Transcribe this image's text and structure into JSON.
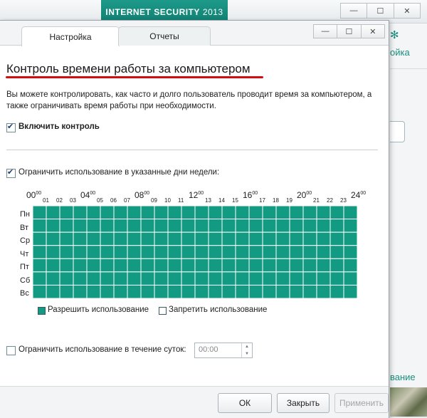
{
  "app": {
    "brand": "INTERNET SECURITY",
    "year": "2013",
    "bg_settings_label": "ойка",
    "bg_link_label": "вание"
  },
  "tabs": [
    {
      "label": "Настройка",
      "active": true
    },
    {
      "label": "Отчеты",
      "active": false
    }
  ],
  "content": {
    "title": "Контроль времени работы за компьютером",
    "description": "Вы можете контролировать, как часто и долго пользователь проводит время за компьютером, а также ограничивать время работы при необходимости.",
    "enable_control_label": "Включить контроль",
    "enable_control_checked": true,
    "limit_days_label": "Ограничить использование в указанные дни недели:",
    "limit_days_checked": true,
    "limit_day_label": "Ограничить использование в течение суток:",
    "limit_day_checked": false,
    "limit_day_value": "00:00"
  },
  "schedule": {
    "days": [
      "Пн",
      "Вт",
      "Ср",
      "Чт",
      "Пт",
      "Сб",
      "Вс"
    ],
    "hour_labels": [
      {
        "text": "00",
        "major": true
      },
      {
        "text": "01",
        "major": false
      },
      {
        "text": "02",
        "major": false
      },
      {
        "text": "03",
        "major": false
      },
      {
        "text": "04",
        "major": true
      },
      {
        "text": "05",
        "major": false
      },
      {
        "text": "06",
        "major": false
      },
      {
        "text": "07",
        "major": false
      },
      {
        "text": "08",
        "major": true
      },
      {
        "text": "09",
        "major": false
      },
      {
        "text": "10",
        "major": false
      },
      {
        "text": "11",
        "major": false
      },
      {
        "text": "12",
        "major": true
      },
      {
        "text": "13",
        "major": false
      },
      {
        "text": "14",
        "major": false
      },
      {
        "text": "15",
        "major": false
      },
      {
        "text": "16",
        "major": true
      },
      {
        "text": "17",
        "major": false
      },
      {
        "text": "18",
        "major": false
      },
      {
        "text": "19",
        "major": false
      },
      {
        "text": "20",
        "major": true
      },
      {
        "text": "21",
        "major": false
      },
      {
        "text": "22",
        "major": false
      },
      {
        "text": "23",
        "major": false
      },
      {
        "text": "24",
        "major": true
      }
    ],
    "hour_superscript": "00",
    "all_allowed": true,
    "allowed_color": "#129a83",
    "denied_color": "#ffffff",
    "legend_allow": "Разрешить использование",
    "legend_deny": "Запретить использование"
  },
  "buttons": {
    "ok": "ОК",
    "close": "Закрыть",
    "apply": "Применить"
  },
  "window_controls": {
    "minimize": "—",
    "maximize": "☐",
    "close": "✕"
  }
}
